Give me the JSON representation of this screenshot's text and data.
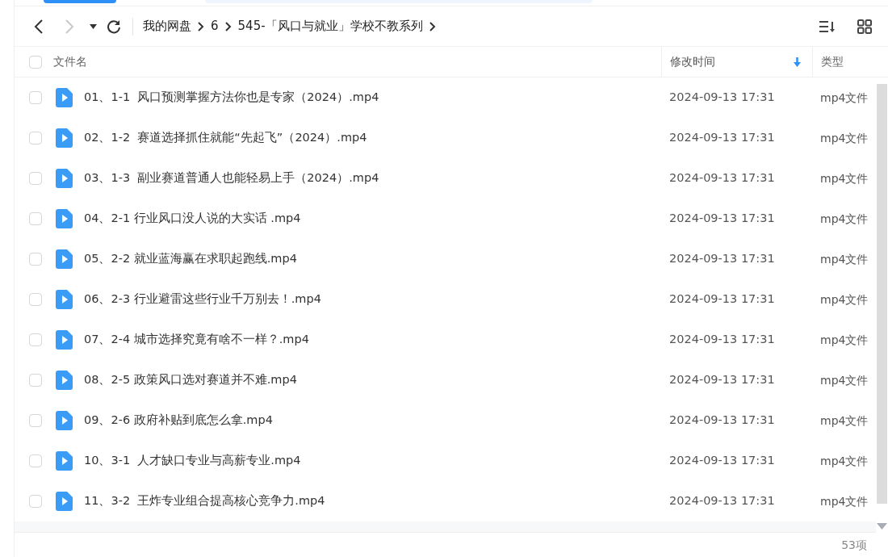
{
  "toolbar": {
    "breadcrumb": [
      "我的网盘",
      "6",
      "545-「风口与就业」学校不教系列"
    ]
  },
  "table": {
    "select_all": {
      "checked": false
    },
    "columns": [
      {
        "label": "文件名",
        "sorted": false
      },
      {
        "label": "修改时间",
        "sorted": true
      },
      {
        "label": "类型",
        "sorted": false
      }
    ],
    "rows": [
      {
        "name": "01、1-1  风口预测掌握方法你也是专家（2024）.mp4",
        "modified": "2024-09-13 17:31",
        "type": "mp4文件",
        "checked": false
      },
      {
        "name": "02、1-2  赛道选择抓住就能“先起飞”（2024）.mp4",
        "modified": "2024-09-13 17:31",
        "type": "mp4文件",
        "checked": false
      },
      {
        "name": "03、1-3  副业赛道普通人也能轻易上手（2024）.mp4",
        "modified": "2024-09-13 17:31",
        "type": "mp4文件",
        "checked": false
      },
      {
        "name": "04、2-1 行业风口没人说的大实话 .mp4",
        "modified": "2024-09-13 17:31",
        "type": "mp4文件",
        "checked": false
      },
      {
        "name": "05、2-2 就业蓝海赢在求职起跑线.mp4",
        "modified": "2024-09-13 17:31",
        "type": "mp4文件",
        "checked": false
      },
      {
        "name": "06、2-3 行业避雷这些行业千万别去！.mp4",
        "modified": "2024-09-13 17:31",
        "type": "mp4文件",
        "checked": false
      },
      {
        "name": "07、2-4 城市选择究竟有啥不一样？.mp4",
        "modified": "2024-09-13 17:31",
        "type": "mp4文件",
        "checked": false
      },
      {
        "name": "08、2-5 政策风口选对赛道并不难.mp4",
        "modified": "2024-09-13 17:31",
        "type": "mp4文件",
        "checked": false
      },
      {
        "name": "09、2-6 政府补贴到底怎么拿.mp4",
        "modified": "2024-09-13 17:31",
        "type": "mp4文件",
        "checked": false
      },
      {
        "name": "10、3-1  人才缺口专业与高薪专业.mp4",
        "modified": "2024-09-13 17:31",
        "type": "mp4文件",
        "checked": false
      },
      {
        "name": "11、3-2  王炸专业组合提高核心竞争力.mp4",
        "modified": "2024-09-13 17:31",
        "type": "mp4文件",
        "checked": false
      }
    ]
  },
  "status_bar": {
    "count": "53项"
  }
}
